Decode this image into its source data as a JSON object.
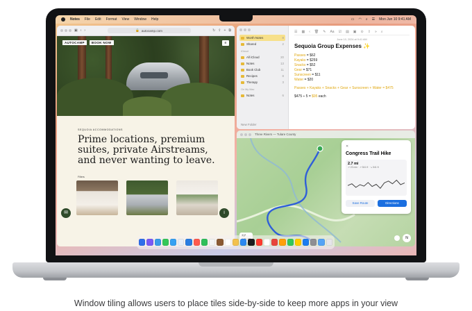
{
  "menubar": {
    "app_name": "Notes",
    "items": [
      "File",
      "Edit",
      "Format",
      "View",
      "Window",
      "Help"
    ],
    "datetime": "Mon Jun 10 9:41 AM"
  },
  "safari": {
    "url": "autocamp.com",
    "brand_name": "AUTOCAMP",
    "book_now": "BOOK NOW",
    "eyebrow": "SEQUOIA ACCOMMODATIONS",
    "headline": "Prime locations, premium suites, private Airstreams, and never wanting to leave.",
    "filters_label": "Filters"
  },
  "notes": {
    "sidebar": [
      {
        "label": "Worth Notes",
        "count": "8"
      },
      {
        "label": "Shared",
        "count": "2"
      }
    ],
    "section_icloud": "iCloud",
    "folders": [
      {
        "label": "All iCloud",
        "count": "20"
      },
      {
        "label": "Notes",
        "count": "13"
      },
      {
        "label": "Book Club",
        "count": "11"
      },
      {
        "label": "Recipes",
        "count": "8"
      },
      {
        "label": "Therapy",
        "count": "3"
      }
    ],
    "section_mac": "On My Mac",
    "mac_folders": [
      {
        "label": "Notes",
        "count": "6"
      }
    ],
    "new_folder": "New Folder",
    "date": "June 10, 2024 at 9:41 AM",
    "title": "Sequoia Group Expenses ✨",
    "lines": [
      {
        "name": "Passes",
        "value": " = $62"
      },
      {
        "name": "Kayaks",
        "value": " = $259"
      },
      {
        "name": "Snacks",
        "value": " = $52"
      },
      {
        "name": "Gear",
        "value": " = $71"
      },
      {
        "name": "Sunscreen",
        "value": " = $11"
      },
      {
        "name": "Water",
        "value": " = $20"
      }
    ],
    "sum_line": "Passes + Kayaks + Snacks + Gear + Sunscreen + Water = $475",
    "split_line_prefix": "$475 ÷ 5 = ",
    "split_value": "$95",
    "split_suffix": " each"
  },
  "maps": {
    "window_title": "Three Rivers — Tulare County",
    "route_title": "Congress Trail Hike",
    "distance": "2.7 mi",
    "stats": "↗ 23 min · ↗ 541 ft · ↘ 541 ft",
    "save_route": "Save Route",
    "directions": "Directions",
    "temperature": "73°",
    "aqi": "AQI 32",
    "compass": "N",
    "close": "✕"
  },
  "caption": "Window tiling allows users to place tiles side-by-side to keep more apps in your view",
  "chart_data": {
    "type": "line",
    "title": "",
    "values": [
      0.45,
      0.55,
      0.35,
      0.5,
      0.42,
      0.62,
      0.4,
      0.52,
      0.3,
      0.6,
      0.7,
      0.55,
      0.75,
      0.5,
      0.6
    ]
  },
  "dock_colors": [
    "#2f6fea",
    "#7a5af5",
    "#3a9be8",
    "#34c759",
    "#36a1f2",
    "#e8eef7",
    "#2a7de1",
    "#ff5a4f",
    "#2fbf5b",
    "#f4f4f4",
    "#8a5a34",
    "#ffffff",
    "#f2c14e",
    "#2b88f0",
    "#1c1c1e",
    "#ff3b30",
    "#ffffff",
    "#e8453c",
    "#ff9f0a",
    "#34c759",
    "#ffcc00",
    "#1c7cf0",
    "#8e8e93",
    "#54a3f5",
    "#e5e5ea"
  ]
}
